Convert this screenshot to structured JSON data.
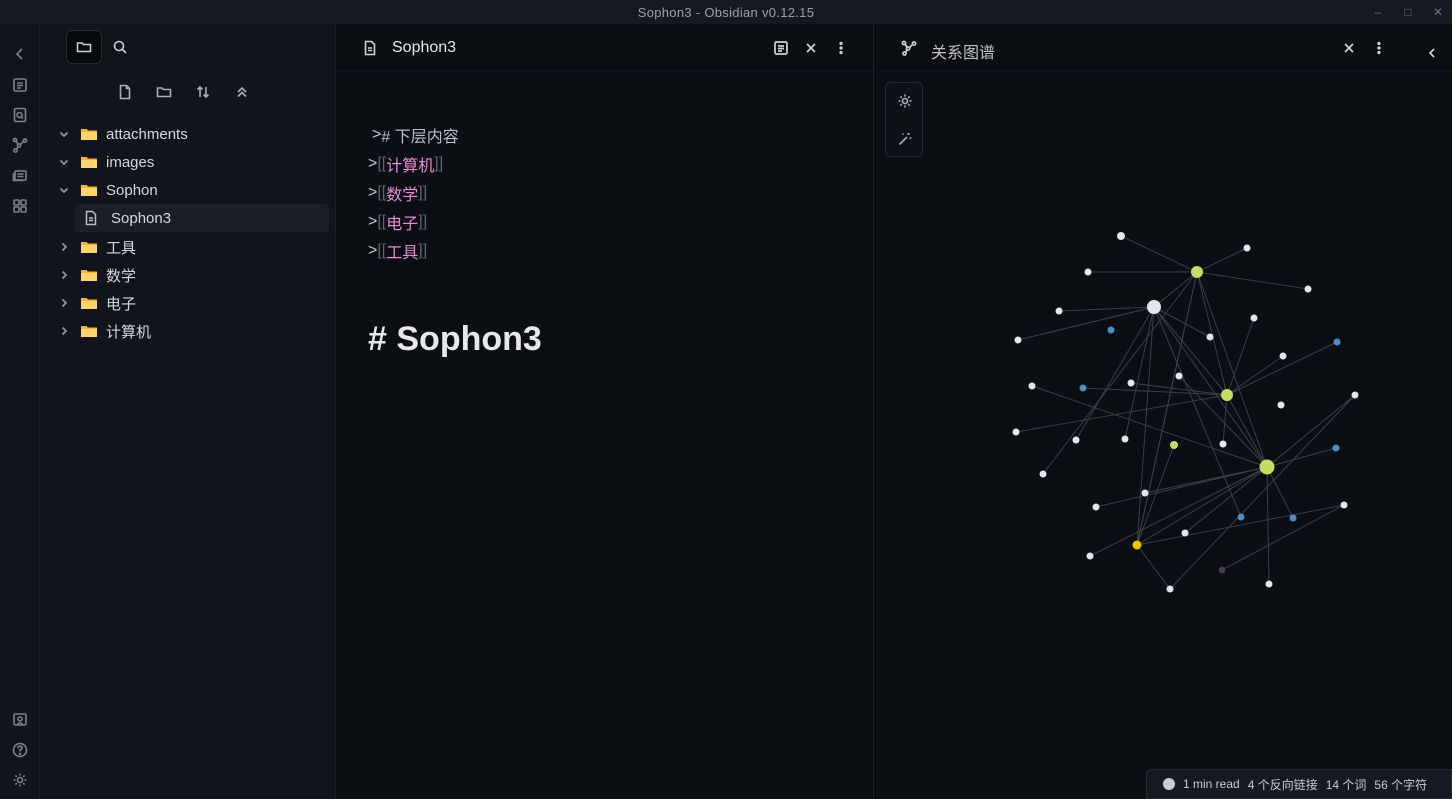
{
  "window": {
    "title": "Sophon3 - Obsidian v0.12.15"
  },
  "file_tree": {
    "folders": [
      {
        "label": "attachments",
        "expanded": true
      },
      {
        "label": "images",
        "expanded": true
      },
      {
        "label": "Sophon",
        "expanded": true
      },
      {
        "label": "工具",
        "expanded": false
      },
      {
        "label": "数学",
        "expanded": false
      },
      {
        "label": "电子",
        "expanded": false
      },
      {
        "label": "计算机",
        "expanded": false
      }
    ],
    "active_file": "Sophon3"
  },
  "editor": {
    "tab_title": "Sophon3",
    "lines": [
      {
        "prefix": "> ",
        "text": "# 下层内容"
      },
      {
        "prefix": ">",
        "open": "[[",
        "link": "计算机",
        "close": "]]"
      },
      {
        "prefix": ">",
        "open": "[[",
        "link": "数学",
        "close": "]]"
      },
      {
        "prefix": ">",
        "open": "[[",
        "link": "电子",
        "close": "]]"
      },
      {
        "prefix": ">",
        "open": "[[",
        "link": "工具",
        "close": "]]"
      }
    ],
    "heading_hash": "#",
    "heading_text": "Sophon3"
  },
  "graph": {
    "tab_title": "关系图谱",
    "colors": {
      "default": "#e4e6ea",
      "tag": "#c6dd64",
      "attachment": "#4b8fc6",
      "highlight": "#f2c400",
      "orphan": "#4d3a4a",
      "edge": "#3a414b"
    }
  },
  "status": {
    "read_time": "1 min read",
    "backlinks": "4 个反向链接",
    "words": "14 个词",
    "chars": "56 个字符"
  }
}
